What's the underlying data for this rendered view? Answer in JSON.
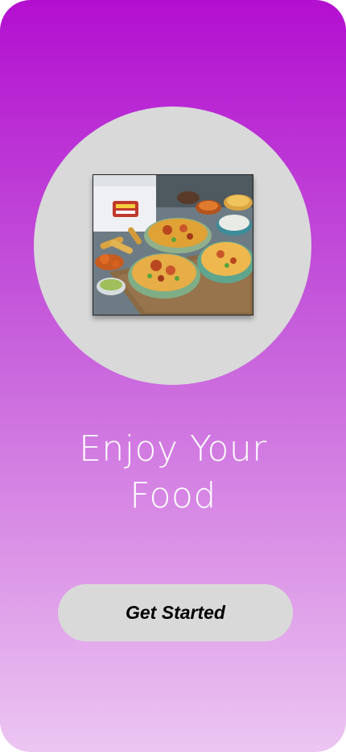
{
  "welcome": {
    "headline_line1": "Enjoy Your",
    "headline_line2": "Food",
    "cta_label": "Get Started"
  },
  "colors": {
    "gradient_top": "#b30fd0",
    "gradient_bottom": "#ecc6f2",
    "circle": "#d9d9d9",
    "button": "#d9d9d9",
    "headline_text": "#ffffff",
    "button_text": "#000000"
  }
}
